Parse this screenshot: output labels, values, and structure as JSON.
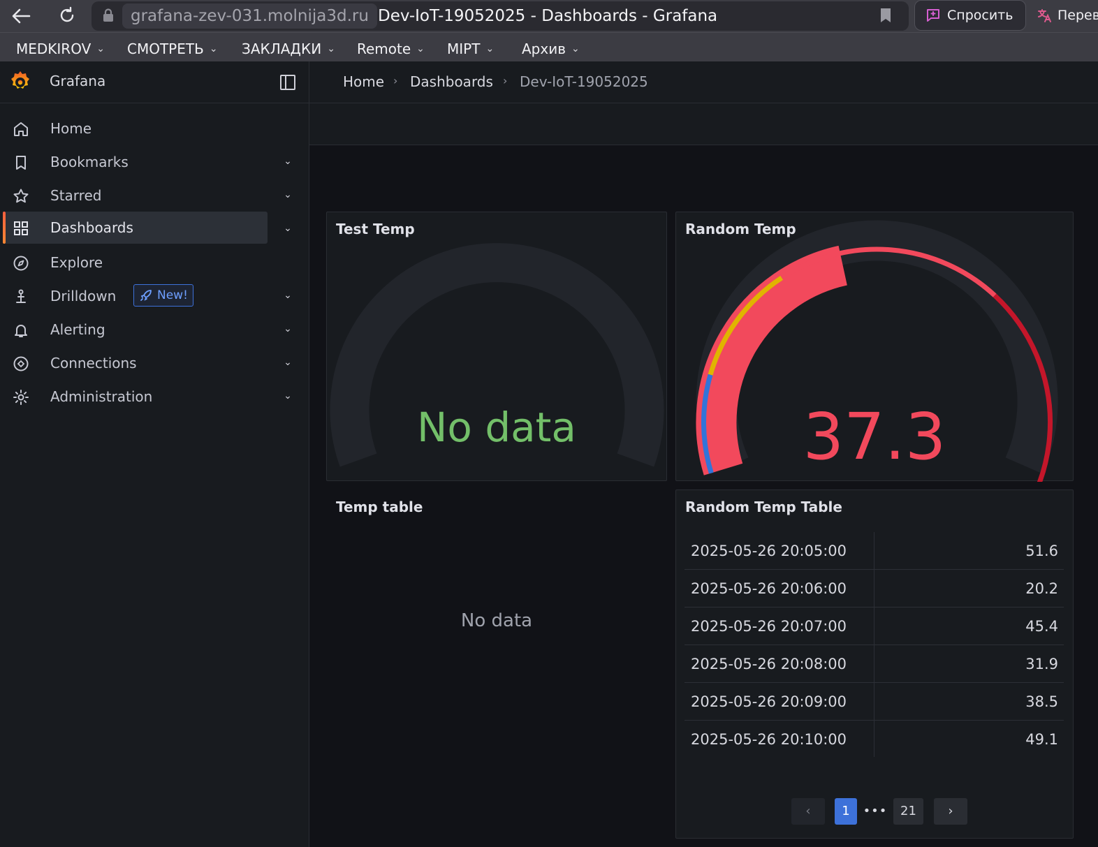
{
  "browser": {
    "url": "grafana-zev-031.molnija3d.ru",
    "tab_title": "Dev-IoT-19052025 - Dashboards - Grafana",
    "ask_label": "Спросить",
    "translate_label": "Переве",
    "bookmarks": [
      "MEDKIROV",
      "СМОТРЕТЬ",
      "ЗАКЛАДКИ",
      "Remote",
      "MIPT",
      "Архив"
    ]
  },
  "sidebar": {
    "brand": "Grafana",
    "items": [
      {
        "label": "Home",
        "icon": "home-icon",
        "chevron": false,
        "active": false
      },
      {
        "label": "Bookmarks",
        "icon": "bookmark-icon",
        "chevron": true,
        "active": false
      },
      {
        "label": "Starred",
        "icon": "star-icon",
        "chevron": true,
        "active": false
      },
      {
        "label": "Dashboards",
        "icon": "apps-icon",
        "chevron": true,
        "active": true
      },
      {
        "label": "Explore",
        "icon": "compass-icon",
        "chevron": false,
        "active": false
      },
      {
        "label": "Drilldown",
        "icon": "drilldown-icon",
        "chevron": true,
        "active": false
      },
      {
        "label": "Alerting",
        "icon": "bell-icon",
        "chevron": true,
        "active": false
      },
      {
        "label": "Connections",
        "icon": "link-icon",
        "chevron": true,
        "active": false
      },
      {
        "label": "Administration",
        "icon": "cog-icon",
        "chevron": true,
        "active": false
      }
    ],
    "drilldown_badge": "New!"
  },
  "breadcrumb": {
    "home": "Home",
    "dashboards": "Dashboards",
    "current": "Dev-IoT-19052025"
  },
  "panels": {
    "test_temp": {
      "title": "Test Temp",
      "value_text": "No data"
    },
    "random_temp": {
      "title": "Random Temp",
      "value_text": "37.3",
      "value": 37.3,
      "min": 0,
      "max": 100,
      "value_color": "#f2495c",
      "threshold_colors": [
        "#3274d9",
        "#e0b400",
        "#f2495c",
        "#c4162a"
      ]
    },
    "temp_table": {
      "title": "Temp table",
      "empty_text": "No data"
    },
    "random_temp_table": {
      "title": "Random Temp Table",
      "rows": [
        {
          "time": "2025-05-26 20:05:00",
          "value": "51.6"
        },
        {
          "time": "2025-05-26 20:06:00",
          "value": "20.2"
        },
        {
          "time": "2025-05-26 20:07:00",
          "value": "45.4"
        },
        {
          "time": "2025-05-26 20:08:00",
          "value": "31.9"
        },
        {
          "time": "2025-05-26 20:09:00",
          "value": "38.5"
        },
        {
          "time": "2025-05-26 20:10:00",
          "value": "49.1"
        }
      ],
      "pagination": {
        "current": "1",
        "ellipsis": "•••",
        "last": "21"
      }
    }
  }
}
